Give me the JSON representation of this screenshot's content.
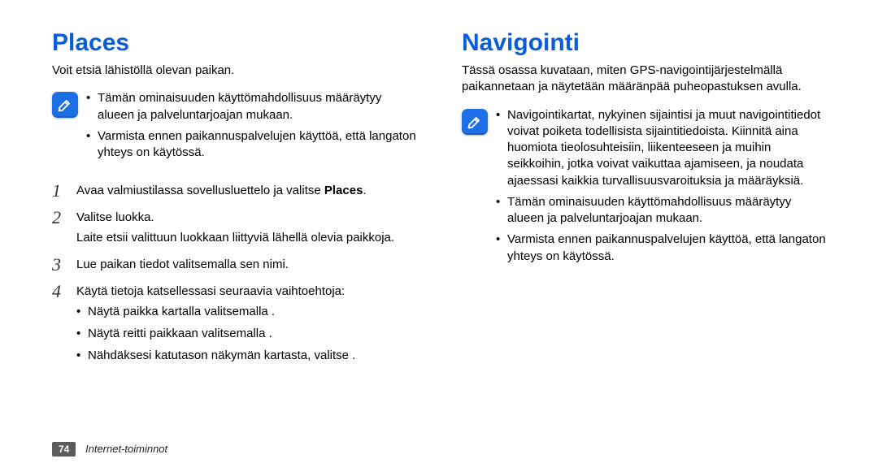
{
  "left": {
    "title": "Places",
    "intro": "Voit etsiä lähistöllä olevan paikan.",
    "note": {
      "items": [
        "Tämän ominaisuuden käyttömahdollisuus määräytyy alueen ja palveluntarjoajan mukaan.",
        "Varmista ennen paikannuspalvelujen käyttöä, että langaton yhteys on käytössä."
      ]
    },
    "steps": [
      {
        "num": "1",
        "lines": [
          "Avaa valmiustilassa sovellusluettelo ja valitse "
        ],
        "strong_suffix": "Places",
        "after_strong": "."
      },
      {
        "num": "2",
        "lines": [
          "Valitse luokka.",
          "Laite etsii valittuun luokkaan liittyviä lähellä olevia paikkoja."
        ]
      },
      {
        "num": "3",
        "lines": [
          "Lue paikan tiedot valitsemalla sen nimi."
        ]
      },
      {
        "num": "4",
        "lines": [
          "Käytä tietoja katsellessasi seuraavia vaihtoehtoja:"
        ],
        "sub": [
          "Näytä paikka kartalla valitsemalla        .",
          "Näytä reitti paikkaan valitsemalla        .",
          "Nähdäksesi katutason näkymän kartasta, valitse        ."
        ]
      }
    ]
  },
  "right": {
    "title": "Navigointi",
    "intro": "Tässä osassa kuvataan, miten GPS-navigointijärjestelmällä paikannetaan ja näytetään määränpää puheopastuksen avulla.",
    "note": {
      "items": [
        "Navigointikartat, nykyinen sijaintisi ja muut navigointitiedot voivat poiketa todellisista sijaintitiedoista. Kiinnitä aina huomiota tieolosuhteisiin, liikenteeseen ja muihin seikkoihin, jotka voivat vaikuttaa ajamiseen, ja noudata ajaessasi kaikkia turvallisuusvaroituksia ja määräyksiä.",
        "Tämän ominaisuuden käyttömahdollisuus määräytyy alueen ja palveluntarjoajan mukaan.",
        "Varmista ennen paikannuspalvelujen käyttöä, että langaton yhteys on käytössä."
      ]
    }
  },
  "footer": {
    "page": "74",
    "section": "Internet-toiminnot"
  }
}
